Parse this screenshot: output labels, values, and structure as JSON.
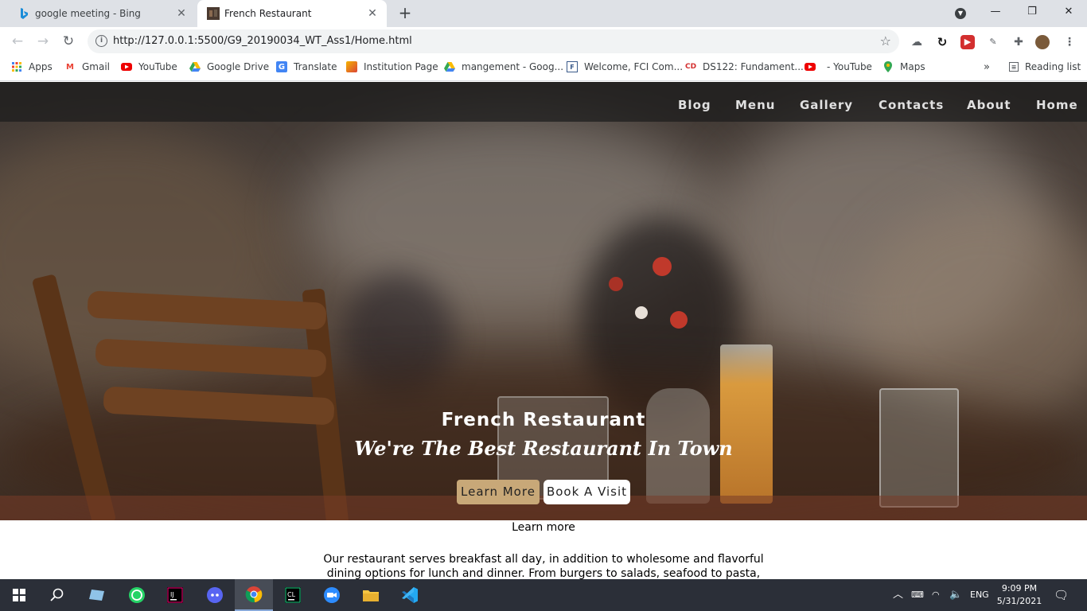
{
  "tabs": [
    {
      "title": "google meeting - Bing",
      "favicon": "bing-icon"
    },
    {
      "title": "French Restaurant",
      "favicon": "restaurant-favicon",
      "active": true
    }
  ],
  "toolbar": {
    "url": "http://127.0.0.1:5500/G9_20190034_WT_Ass1/Home.html"
  },
  "bookmarks": {
    "items": [
      {
        "label": "Apps",
        "icon": "apps-grid-icon"
      },
      {
        "label": "Gmail",
        "icon": "gmail-icon"
      },
      {
        "label": "YouTube",
        "icon": "youtube-icon"
      },
      {
        "label": "Google Drive",
        "icon": "google-drive-icon"
      },
      {
        "label": "Translate",
        "icon": "translate-icon"
      },
      {
        "label": "Institution Page",
        "icon": "institution-icon"
      },
      {
        "label": "mangement - Goog...",
        "icon": "google-drive-icon"
      },
      {
        "label": "Welcome, FCI Com...",
        "icon": "fci-icon"
      },
      {
        "label": "DS122: Fundament...",
        "icon": "ds-icon"
      },
      {
        "label": "- YouTube",
        "icon": "youtube-icon"
      },
      {
        "label": "Maps",
        "icon": "maps-icon"
      }
    ],
    "overflow": "»",
    "reading_list": "Reading list"
  },
  "site": {
    "nav": [
      "Blog",
      "Menu",
      "Gallery",
      "Contacts",
      "About",
      "Home"
    ],
    "hero_title": "French Restaurant",
    "hero_subtitle": "We're The Best Restaurant In Town",
    "learn_more_btn": "Learn More",
    "book_visit_btn": "Book A Visit",
    "learn_more_label": "Learn more",
    "about_line1": "Our restaurant serves breakfast all day, in addition to wholesome and flavorful",
    "about_line2": "dining options for lunch and dinner. From burgers to salads, seafood to pasta,"
  },
  "taskbar": {
    "language": "ENG",
    "time": "9:09 PM",
    "date": "5/31/2021"
  }
}
